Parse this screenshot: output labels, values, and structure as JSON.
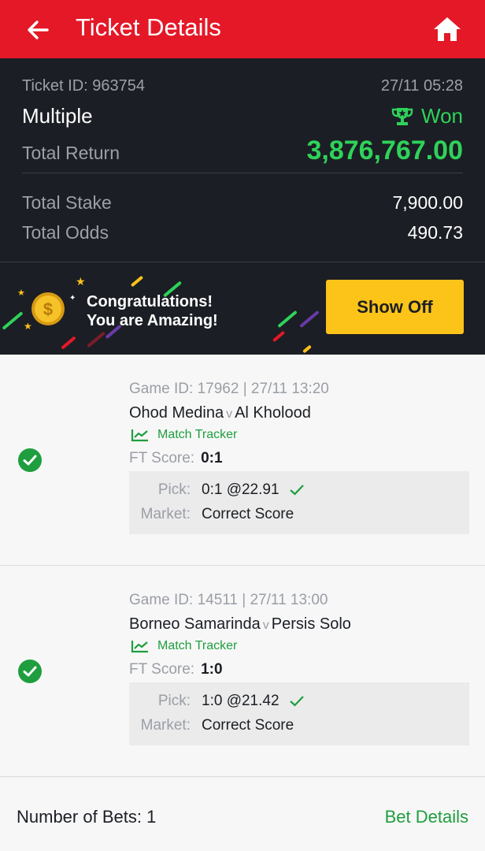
{
  "header": {
    "title": "Ticket Details",
    "back_icon": "arrow-left-icon",
    "home_icon": "home-icon"
  },
  "ticket": {
    "id_text": "Ticket ID: 963754",
    "datetime": "27/11 05:28",
    "type": "Multiple",
    "status": "Won",
    "total_return_label": "Total Return",
    "total_return_value": "3,876,767.00",
    "total_stake_label": "Total Stake",
    "total_stake_value": "7,900.00",
    "total_odds_label": "Total Odds",
    "total_odds_value": "490.73"
  },
  "banner": {
    "line1": "Congratulations!",
    "line2": "You are Amazing!",
    "button": "Show Off"
  },
  "bets": [
    {
      "game": "Game ID: 17962 | 27/11 13:20",
      "home": "Ohod Medina",
      "vs": "v",
      "away": "Al Kholood",
      "tracker": "Match Tracker",
      "ft_label": "FT Score:",
      "ft_value": "0:1",
      "pick_label": "Pick:",
      "pick_value": "0:1 @22.91",
      "market_label": "Market:",
      "market_value": "Correct Score"
    },
    {
      "game": "Game ID: 14511 | 27/11 13:00",
      "home": "Borneo Samarinda",
      "vs": "v",
      "away": "Persis Solo",
      "tracker": "Match Tracker",
      "ft_label": "FT Score:",
      "ft_value": "1:0",
      "pick_label": "Pick:",
      "pick_value": "1:0 @21.42",
      "market_label": "Market:",
      "market_value": "Correct Score"
    }
  ],
  "footer": {
    "count": "Number of Bets: 1",
    "details": "Bet Details"
  },
  "colors": {
    "brand_red": "#e41827",
    "win_green": "#2fd25a",
    "link_green": "#1e9e3e",
    "button_yellow": "#fcc319",
    "dark_bg": "#1b1e24"
  }
}
